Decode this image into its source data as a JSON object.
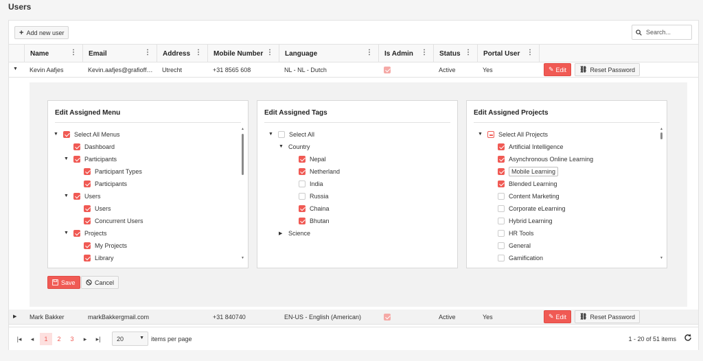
{
  "page_title": "Users",
  "toolbar": {
    "add_label": "Add new user",
    "search_placeholder": "Search..."
  },
  "columns": [
    "Name",
    "Email",
    "Address",
    "Mobile Number",
    "Language",
    "Is Admin",
    "Status",
    "Portal User"
  ],
  "rows": [
    {
      "name": "Kevin Aafjes",
      "email": "Kevin.aafjes@grafioff…",
      "address": "Utrecht",
      "mobile": "+31 8565 608",
      "language": "NL - NL - Dutch",
      "is_admin": true,
      "status": "Active",
      "portal_user": "Yes",
      "edit_label": "Edit",
      "reset_label": "Reset Password"
    },
    {
      "name": "Mark Bakker",
      "email": "markBakkergmail.com",
      "address": "",
      "mobile": "+31 840740",
      "language": "EN-US - English (American)",
      "is_admin": true,
      "status": "Active",
      "portal_user": "Yes",
      "edit_label": "Edit",
      "reset_label": "Reset Password"
    }
  ],
  "detail": {
    "menu_panel": {
      "title": "Edit Assigned Menu",
      "items": [
        {
          "label": "Select All Menus",
          "level": 0,
          "expand": "open",
          "state": "on"
        },
        {
          "label": "Dashboard",
          "level": 1,
          "expand": "none",
          "state": "on"
        },
        {
          "label": "Participants",
          "level": 1,
          "expand": "open",
          "state": "on"
        },
        {
          "label": "Participant Types",
          "level": 2,
          "expand": "none",
          "state": "on"
        },
        {
          "label": "Participants",
          "level": 2,
          "expand": "none",
          "state": "on"
        },
        {
          "label": "Users",
          "level": 1,
          "expand": "open",
          "state": "on"
        },
        {
          "label": "Users",
          "level": 2,
          "expand": "none",
          "state": "on"
        },
        {
          "label": "Concurrent Users",
          "level": 2,
          "expand": "none",
          "state": "on"
        },
        {
          "label": "Projects",
          "level": 1,
          "expand": "open",
          "state": "on"
        },
        {
          "label": "My Projects",
          "level": 2,
          "expand": "none",
          "state": "on"
        },
        {
          "label": "Library",
          "level": 2,
          "expand": "none",
          "state": "on"
        }
      ]
    },
    "tags_panel": {
      "title": "Edit Assigned Tags",
      "items": [
        {
          "label": "Select All",
          "level": 0,
          "expand": "open",
          "state": "off"
        },
        {
          "label": "Country",
          "level": 1,
          "expand": "open",
          "state": "none"
        },
        {
          "label": "Nepal",
          "level": 2,
          "expand": "none",
          "state": "on"
        },
        {
          "label": "Netherland",
          "level": 2,
          "expand": "none",
          "state": "on"
        },
        {
          "label": "India",
          "level": 2,
          "expand": "none",
          "state": "off"
        },
        {
          "label": "Russia",
          "level": 2,
          "expand": "none",
          "state": "off"
        },
        {
          "label": "Chaina",
          "level": 2,
          "expand": "none",
          "state": "on"
        },
        {
          "label": "Bhutan",
          "level": 2,
          "expand": "none",
          "state": "on"
        },
        {
          "label": "Science",
          "level": 1,
          "expand": "closed",
          "state": "none"
        }
      ]
    },
    "projects_panel": {
      "title": "Edit Assigned Projects",
      "items": [
        {
          "label": "Select All Projects",
          "level": 0,
          "expand": "open",
          "state": "ind"
        },
        {
          "label": "Artificial Intelligence",
          "level": 1,
          "expand": "none",
          "state": "on"
        },
        {
          "label": "Asynchronous Online Learning",
          "level": 1,
          "expand": "none",
          "state": "on"
        },
        {
          "label": "Mobile Learning",
          "level": 1,
          "expand": "none",
          "state": "on",
          "focused": true
        },
        {
          "label": "Blended Learning",
          "level": 1,
          "expand": "none",
          "state": "on"
        },
        {
          "label": "Content Marketing",
          "level": 1,
          "expand": "none",
          "state": "off"
        },
        {
          "label": "Corporate eLearning",
          "level": 1,
          "expand": "none",
          "state": "off"
        },
        {
          "label": "Hybrid Learning",
          "level": 1,
          "expand": "none",
          "state": "off"
        },
        {
          "label": "HR Tools",
          "level": 1,
          "expand": "none",
          "state": "off"
        },
        {
          "label": "General",
          "level": 1,
          "expand": "none",
          "state": "off"
        },
        {
          "label": "Gamification",
          "level": 1,
          "expand": "none",
          "state": "off"
        }
      ]
    },
    "save_label": "Save",
    "cancel_label": "Cancel"
  },
  "pager": {
    "pages": [
      "1",
      "2",
      "3"
    ],
    "current_page": "1",
    "page_size": "20",
    "items_per_page_label": "items per page",
    "range_label": "1 - 20 of 51 items"
  },
  "colors": {
    "accent": "#f05a54",
    "accent_light": "#fde0df"
  },
  "icons": [
    "plus-icon",
    "search-icon",
    "kebab-icon",
    "pencil-icon",
    "link-icon",
    "save-icon",
    "cancel-icon",
    "refresh-icon"
  ]
}
